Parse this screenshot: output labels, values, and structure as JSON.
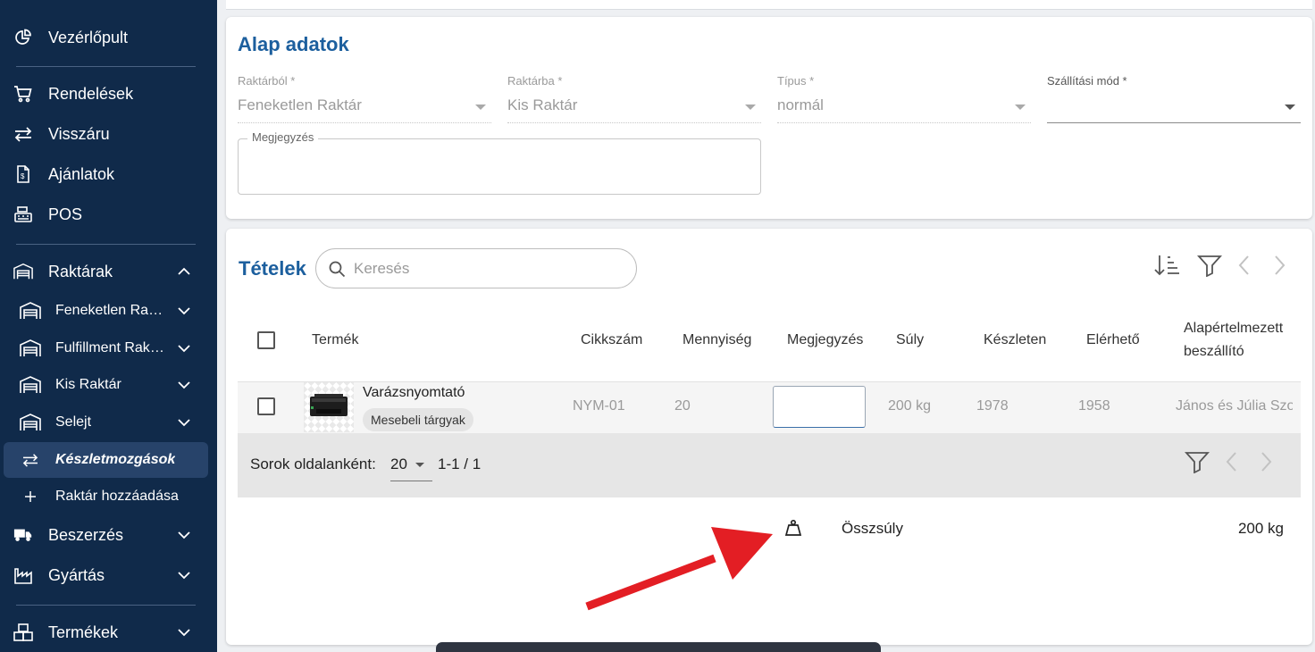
{
  "sidebar": {
    "items": [
      {
        "label": "Vezérlőpult",
        "icon": "pie-chart-icon"
      },
      {
        "label": "Rendelések",
        "icon": "cart-icon"
      },
      {
        "label": "Visszáru",
        "icon": "swap-icon"
      },
      {
        "label": "Ajánlatok",
        "icon": "document-dollar-icon"
      },
      {
        "label": "POS",
        "icon": "cash-register-icon"
      },
      {
        "label": "Raktárak",
        "icon": "warehouse-icon"
      },
      {
        "label": "Beszerzés",
        "icon": "truck-icon"
      },
      {
        "label": "Gyártás",
        "icon": "factory-icon"
      },
      {
        "label": "Termékek",
        "icon": "boxes-icon"
      }
    ],
    "warehouses": [
      {
        "label": "Feneketlen Raktár"
      },
      {
        "label": "Fulfillment Raktár"
      },
      {
        "label": "Kis Raktár"
      },
      {
        "label": "Selejt"
      }
    ],
    "stock_movements": "Készletmozgások",
    "add_warehouse": "Raktár hozzáadása"
  },
  "basic": {
    "title": "Alap adatok",
    "from_label": "Raktárból *",
    "from_value": "Feneketlen Raktár",
    "to_label": "Raktárba *",
    "to_value": "Kis Raktár",
    "type_label": "Típus *",
    "type_value": "normál",
    "shipping_label": "Szállítási mód *",
    "shipping_value": "",
    "notes_label": "Megjegyzés"
  },
  "items": {
    "title": "Tételek",
    "search_placeholder": "Keresés",
    "columns": {
      "product": "Termék",
      "sku": "Cikkszám",
      "qty": "Mennyiség",
      "notes": "Megjegyzés",
      "weight": "Súly",
      "stock": "Készleten",
      "available": "Elérhető",
      "supplier_1": "Alapértelmezett",
      "supplier_2": "beszállító"
    },
    "rows": [
      {
        "name": "Varázsnyomtató",
        "category": "Mesebeli tárgyak",
        "sku": "NYM-01",
        "qty": "20",
        "weight": "200 kg",
        "stock": "1978",
        "available": "1958",
        "supplier": "János és Júlia Szolgáltató"
      }
    ],
    "rows_per_page_label": "Sorok oldalanként:",
    "rows_per_page": "20",
    "range": "1-1 / 1",
    "total_label": "Összsúly",
    "total_value": "200 kg"
  },
  "colors": {
    "sidebar_bg": "#102a4a",
    "accent": "#1c5f9e",
    "arrow": "#e31e24"
  }
}
